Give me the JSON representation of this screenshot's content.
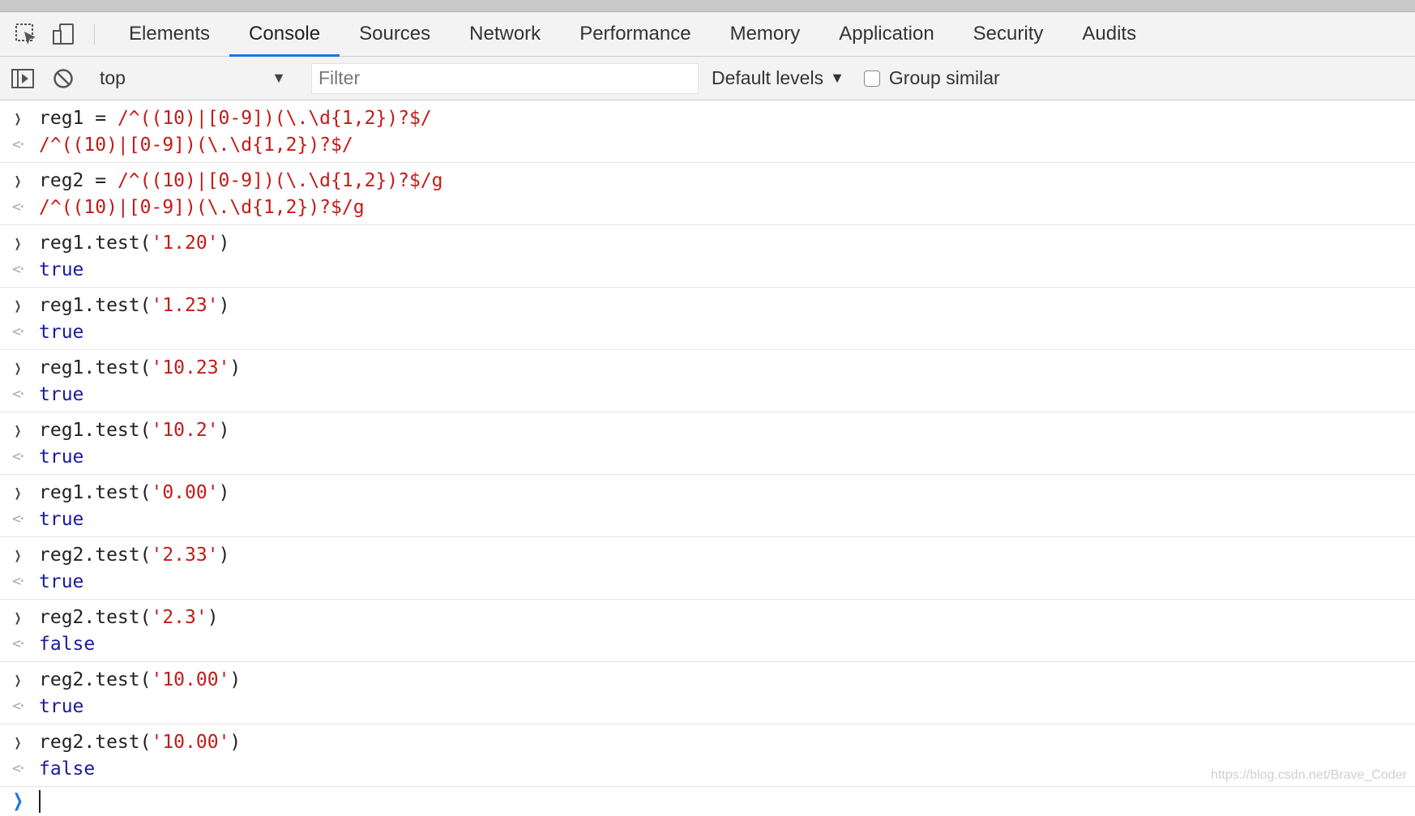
{
  "tabs": [
    "Elements",
    "Console",
    "Sources",
    "Network",
    "Performance",
    "Memory",
    "Application",
    "Security",
    "Audits"
  ],
  "active_tab": "Console",
  "toolbar": {
    "context": "top",
    "filter_placeholder": "Filter",
    "levels_label": "Default levels",
    "group_similar_label": "Group similar",
    "group_similar_checked": false
  },
  "console": {
    "entries": [
      {
        "input_var": "reg1",
        "input_op": " = ",
        "input_regex": "/^((10)|[0-9])(\\.\\d{1,2})?$/",
        "output": "/^((10)|[0-9])(\\.\\d{1,2})?$/"
      },
      {
        "input_var": "reg2",
        "input_op": " = ",
        "input_regex": "/^((10)|[0-9])(\\.\\d{1,2})?$/g",
        "output": "/^((10)|[0-9])(\\.\\d{1,2})?$/g"
      },
      {
        "call": "reg1.test(",
        "arg": "'1.20'",
        "close": ")",
        "output": "true"
      },
      {
        "call": "reg1.test(",
        "arg": "'1.23'",
        "close": ")",
        "output": "true"
      },
      {
        "call": "reg1.test(",
        "arg": "'10.23'",
        "close": ")",
        "output": "true"
      },
      {
        "call": "reg1.test(",
        "arg": "'10.2'",
        "close": ")",
        "output": "true"
      },
      {
        "call": "reg1.test(",
        "arg": "'0.00'",
        "close": ")",
        "output": "true"
      },
      {
        "call": "reg2.test(",
        "arg": "'2.33'",
        "close": ")",
        "output": "true"
      },
      {
        "call": "reg2.test(",
        "arg": "'2.3'",
        "close": ")",
        "output": "false"
      },
      {
        "call": "reg2.test(",
        "arg": "'10.00'",
        "close": ")",
        "output": "true"
      },
      {
        "call": "reg2.test(",
        "arg": "'10.00'",
        "close": ")",
        "output": "false"
      }
    ]
  },
  "watermark": "https://blog.csdn.net/Brave_Coder",
  "colors": {
    "accent": "#1a73e8",
    "regex_string": "#c41a16",
    "boolean": "#1a1aa6"
  }
}
